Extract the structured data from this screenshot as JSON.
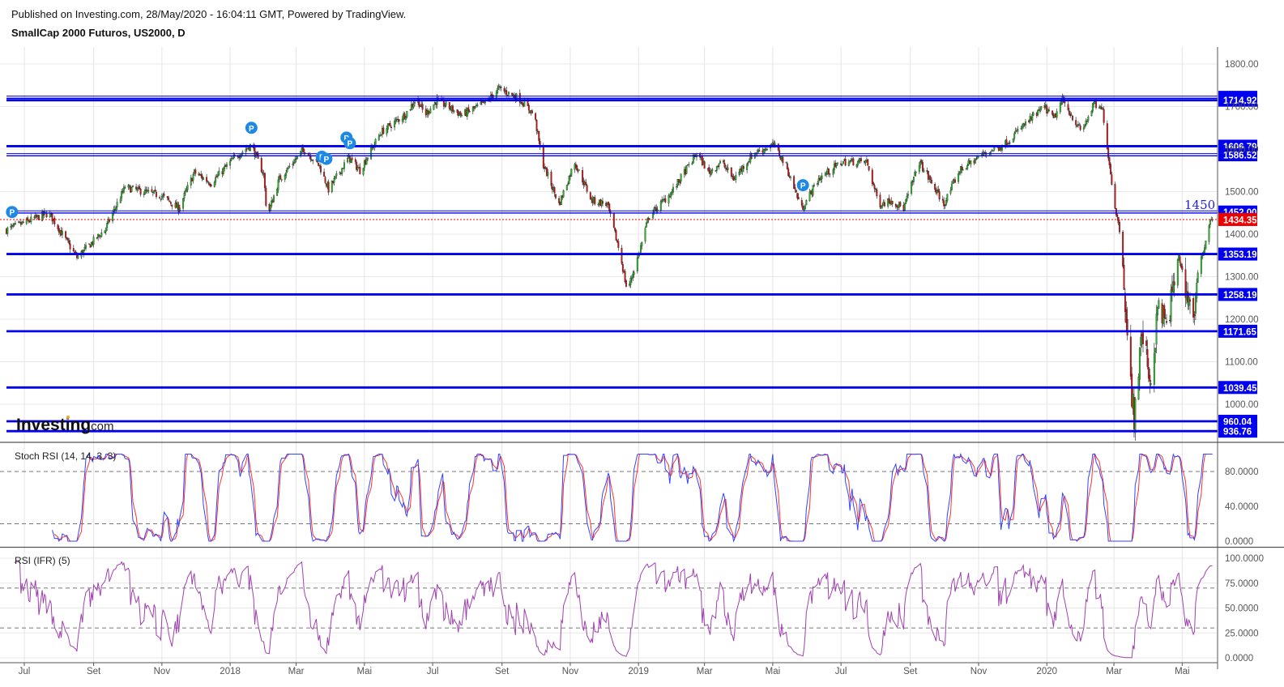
{
  "header": {
    "published": "Published on Investing.com, 28/May/2020 - 16:04:11 GMT, Powered by TradingView.",
    "symbol_title": "SmallCap 2000 Futuros, US2000, D"
  },
  "logo": {
    "brand": "Investing",
    "suffix": ".com"
  },
  "colors": {
    "up": "#22bb22",
    "down": "#cc1111",
    "level": "#0000ee",
    "last": "#ee0000",
    "stoch_k": "#3344ff",
    "stoch_d": "#ff3333",
    "rsi": "#a040b0"
  },
  "chart_data": {
    "type": "candlestick",
    "title": "SmallCap 2000 Futuros, US2000, D",
    "price_axis": {
      "ylim": [
        900,
        1850
      ],
      "ticks": [
        "1800.00",
        "1700.00",
        "1600.00",
        "1500.00",
        "1400.00",
        "1300.00",
        "1200.00",
        "1100.00",
        "1000.00"
      ],
      "tick_values": [
        1800,
        1700,
        1600,
        1500,
        1400,
        1300,
        1200,
        1100,
        1000
      ]
    },
    "x_ticks": [
      {
        "label": "Jul",
        "date": "2017-07-01"
      },
      {
        "label": "Set",
        "date": "2017-09-01"
      },
      {
        "label": "Nov",
        "date": "2017-11-01"
      },
      {
        "label": "2018",
        "date": "2018-01-01"
      },
      {
        "label": "Mar",
        "date": "2018-03-01"
      },
      {
        "label": "Mai",
        "date": "2018-05-01"
      },
      {
        "label": "Jul",
        "date": "2018-07-01"
      },
      {
        "label": "Set",
        "date": "2018-09-01"
      },
      {
        "label": "Nov",
        "date": "2018-11-01"
      },
      {
        "label": "2019",
        "date": "2019-01-01"
      },
      {
        "label": "Mar",
        "date": "2019-03-01"
      },
      {
        "label": "Mai",
        "date": "2019-05-01"
      },
      {
        "label": "Jul",
        "date": "2019-07-01"
      },
      {
        "label": "Set",
        "date": "2019-09-01"
      },
      {
        "label": "Nov",
        "date": "2019-11-01"
      },
      {
        "label": "2020",
        "date": "2020-01-01"
      },
      {
        "label": "Mar",
        "date": "2020-03-01"
      },
      {
        "label": "Mai",
        "date": "2020-05-01"
      }
    ],
    "approx_close_path": [
      [
        "2017-06-15",
        1410
      ],
      [
        "2017-07-23",
        1450
      ],
      [
        "2017-08-17",
        1345
      ],
      [
        "2017-09-11",
        1410
      ],
      [
        "2017-09-29",
        1510
      ],
      [
        "2017-11-01",
        1490
      ],
      [
        "2017-11-16",
        1460
      ],
      [
        "2017-11-30",
        1545
      ],
      [
        "2017-12-15",
        1520
      ],
      [
        "2018-01-05",
        1580
      ],
      [
        "2018-01-20",
        1610
      ],
      [
        "2018-01-31",
        1540
      ],
      [
        "2018-02-03",
        1440
      ],
      [
        "2018-02-14",
        1530
      ],
      [
        "2018-03-08",
        1600
      ],
      [
        "2018-03-22",
        1560
      ],
      [
        "2018-03-30",
        1505
      ],
      [
        "2018-04-17",
        1580
      ],
      [
        "2018-04-27",
        1550
      ],
      [
        "2018-05-16",
        1640
      ],
      [
        "2018-06-06",
        1680
      ],
      [
        "2018-06-17",
        1720
      ],
      [
        "2018-06-24",
        1680
      ],
      [
        "2018-07-05",
        1715
      ],
      [
        "2018-07-27",
        1680
      ],
      [
        "2018-08-18",
        1710
      ],
      [
        "2018-08-29",
        1742
      ],
      [
        "2018-09-16",
        1720
      ],
      [
        "2018-09-30",
        1680
      ],
      [
        "2018-10-07",
        1570
      ],
      [
        "2018-10-22",
        1470
      ],
      [
        "2018-11-05",
        1570
      ],
      [
        "2018-11-20",
        1480
      ],
      [
        "2018-12-04",
        1470
      ],
      [
        "2018-12-15",
        1360
      ],
      [
        "2018-12-22",
        1265
      ],
      [
        "2019-01-02",
        1360
      ],
      [
        "2019-01-10",
        1440
      ],
      [
        "2019-01-31",
        1500
      ],
      [
        "2019-02-22",
        1590
      ],
      [
        "2019-03-05",
        1545
      ],
      [
        "2019-03-16",
        1570
      ],
      [
        "2019-03-27",
        1530
      ],
      [
        "2019-04-14",
        1590
      ],
      [
        "2019-05-02",
        1610
      ],
      [
        "2019-05-13",
        1560
      ],
      [
        "2019-05-27",
        1460
      ],
      [
        "2019-06-11",
        1530
      ],
      [
        "2019-07-02",
        1570
      ],
      [
        "2019-07-24",
        1570
      ],
      [
        "2019-08-04",
        1470
      ],
      [
        "2019-08-15",
        1480
      ],
      [
        "2019-08-26",
        1460
      ],
      [
        "2019-09-09",
        1570
      ],
      [
        "2019-10-01",
        1470
      ],
      [
        "2019-10-15",
        1550
      ],
      [
        "2019-11-06",
        1590
      ],
      [
        "2019-11-24",
        1610
      ],
      [
        "2019-12-09",
        1650
      ],
      [
        "2019-12-30",
        1700
      ],
      [
        "2020-01-07",
        1670
      ],
      [
        "2020-01-15",
        1715
      ],
      [
        "2020-02-01",
        1640
      ],
      [
        "2020-02-12",
        1705
      ],
      [
        "2020-02-20",
        1690
      ],
      [
        "2020-03-01",
        1480
      ],
      [
        "2020-03-08",
        1380
      ],
      [
        "2020-03-14",
        1100
      ],
      [
        "2020-03-19",
        970
      ],
      [
        "2020-03-26",
        1170
      ],
      [
        "2020-04-03",
        1050
      ],
      [
        "2020-04-10",
        1240
      ],
      [
        "2020-04-17",
        1180
      ],
      [
        "2020-04-28",
        1350
      ],
      [
        "2020-05-05",
        1260
      ],
      [
        "2020-05-12",
        1210
      ],
      [
        "2020-05-16",
        1330
      ],
      [
        "2020-05-23",
        1390
      ],
      [
        "2020-05-26",
        1440
      ],
      [
        "2020-05-28",
        1434.35
      ]
    ],
    "last_price": {
      "value": 1434.35,
      "label": "1434.35"
    },
    "levels": [
      {
        "value": 1721.68,
        "label": "1721.68",
        "style": "double"
      },
      {
        "value": 1714.92,
        "label": "1714.92",
        "style": "thick"
      },
      {
        "value": 1606.79,
        "label": "1606.79",
        "style": "thick"
      },
      {
        "value": 1586.52,
        "label": "1586.52",
        "style": "double"
      },
      {
        "value": 1452.0,
        "label": "1452.00",
        "style": "double"
      },
      {
        "value": 1353.19,
        "label": "1353.19",
        "style": "thick"
      },
      {
        "value": 1258.19,
        "label": "1258.19",
        "style": "thick"
      },
      {
        "value": 1171.65,
        "label": "1171.65",
        "style": "thick"
      },
      {
        "value": 1039.45,
        "label": "1039.45",
        "style": "thick"
      },
      {
        "value": 960.04,
        "label": "960.04",
        "style": "thick"
      },
      {
        "value": 936.76,
        "label": "936.76",
        "style": "thick"
      }
    ],
    "annotation": {
      "text": "1450",
      "value": 1450
    },
    "markers": {
      "label": "P",
      "items": [
        {
          "date": "2017-06-20",
          "price": 1452
        },
        {
          "date": "2018-01-20",
          "price": 1650
        },
        {
          "date": "2018-03-24",
          "price": 1582
        },
        {
          "date": "2018-03-28",
          "price": 1577
        },
        {
          "date": "2018-04-15",
          "price": 1627
        },
        {
          "date": "2018-04-18",
          "price": 1614
        },
        {
          "date": "2019-05-28",
          "price": 1515
        }
      ]
    },
    "stoch_rsi": {
      "title": "Stoch RSI (14, 14, 3, 3)",
      "params": [
        14,
        14,
        3,
        3
      ],
      "ylim": [
        0,
        100
      ],
      "ticks": [
        "80.0000",
        "40.0000",
        "0.0000"
      ],
      "tick_values": [
        80,
        40,
        0
      ],
      "bands": [
        80,
        20
      ]
    },
    "rsi": {
      "title": "RSI (IFR) (5)",
      "period": 5,
      "ylim": [
        0,
        100
      ],
      "ticks": [
        "100.0000",
        "75.0000",
        "50.0000",
        "25.0000",
        "0.0000"
      ],
      "tick_values": [
        100,
        75,
        50,
        25,
        0
      ],
      "bands": [
        70,
        30
      ]
    }
  }
}
